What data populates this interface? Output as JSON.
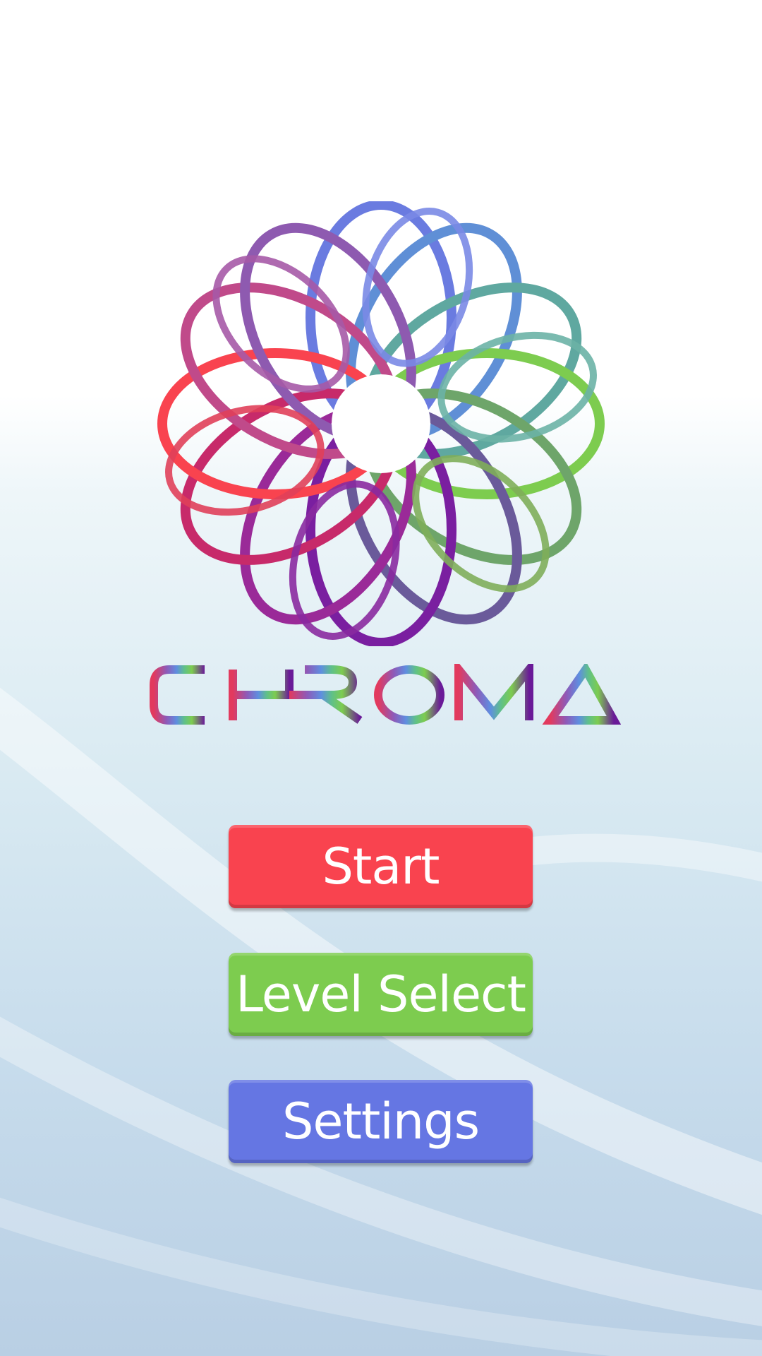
{
  "app": {
    "title": "CHROMA"
  },
  "logo": {
    "icon": "chroma-rosette-logo",
    "colors": {
      "red": "#f9434f",
      "blue": "#6576e3",
      "green": "#7dcc4f",
      "purple": "#7a1fa0",
      "teal": "#5fa8a0"
    }
  },
  "menu": {
    "start_label": "Start",
    "level_select_label": "Level Select",
    "settings_label": "Settings",
    "colors": {
      "start": "#f9434f",
      "level_select": "#7dcc4f",
      "settings": "#6576e3"
    }
  }
}
